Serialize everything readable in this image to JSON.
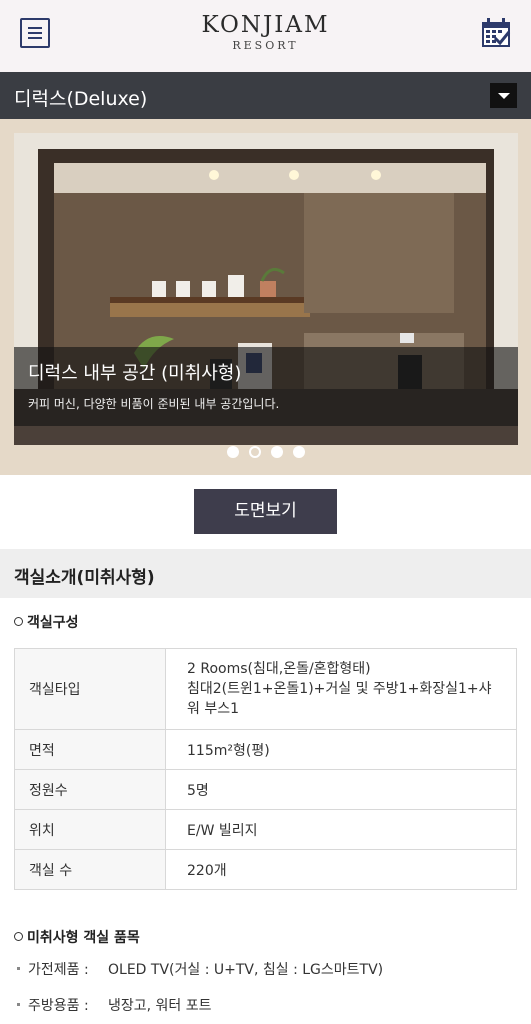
{
  "header": {
    "logo_main": "KONJIAM",
    "logo_sub": "RESORT",
    "menu_icon": "hamburger-menu-icon",
    "calendar_icon": "calendar-check-icon"
  },
  "room_selector": {
    "selected": "디럭스(Deluxe)"
  },
  "carousel": {
    "caption_title": "디럭스 내부 공간 (미취사형)",
    "caption_sub": "커피 머신, 다양한 비품이 준비된 내부 공간입니다.",
    "slide_count": 4,
    "active_index": 0
  },
  "floor_plan_button": "도면보기",
  "section": {
    "title": "객실소개(미취사형)",
    "composition_heading": "객실구성",
    "specs": [
      {
        "key": "객실타입",
        "value_lines": [
          "2 Rooms(침대,온돌/혼합형태)",
          "침대2(트윈1+온돌1)+거실 및 주방1+화장실1+샤",
          "워 부스1"
        ]
      },
      {
        "key": "면적",
        "value": "115m²형(평)"
      },
      {
        "key": "정원수",
        "value": "5명"
      },
      {
        "key": "위치",
        "value": "E/W 빌리지"
      },
      {
        "key": "객실 수",
        "value": "220개"
      }
    ],
    "items_heading": "미취사형 객실 품목",
    "items": [
      {
        "label": "가전제품 :",
        "value": "OLED TV(거실 : U+TV, 침실 : LG스마트TV)"
      },
      {
        "label": "주방용품 :",
        "value": "냉장고, 워터 포트"
      }
    ]
  },
  "colors": {
    "header_bg": "#f7f3f5",
    "room_bar_bg": "#3a3d43",
    "plan_button_bg": "#3e3d4c",
    "brand_navy": "#2d3a6b"
  }
}
